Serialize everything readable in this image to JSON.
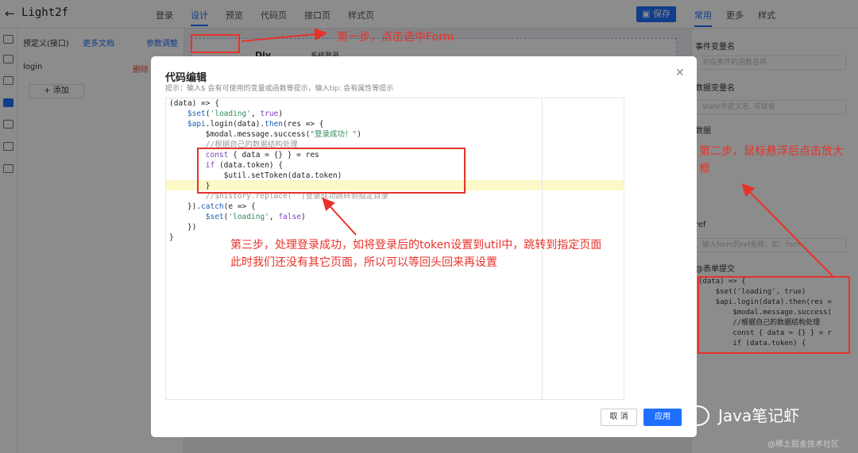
{
  "header": {
    "back_icon": "arrow-left-icon",
    "title": "Light2f",
    "tabs": [
      "登录",
      "设计",
      "预览",
      "代码页",
      "接口页",
      "样式页"
    ],
    "active_tab": "设计",
    "save_label": "保存",
    "right_tabs": [
      "常用",
      "更多",
      "样式"
    ]
  },
  "left_panel": {
    "heading": "预定义(接口)",
    "more_docs": "更多文档",
    "param_adjust": "参数调整",
    "item_name": "login",
    "delete_label": "删除",
    "add_label": "添加"
  },
  "canvas": {
    "div_label": "Div",
    "tag_label": "系统登录"
  },
  "right_panel": {
    "event_var_label": "事件变量名",
    "event_var_placeholder": "对应事件的函数名称",
    "data_var_label": "数据变量名",
    "data_var_placeholder": "state中定义名, 可缺省",
    "data_label": "数据",
    "ref_label": "ref",
    "ref_placeholder": "输入form的ref名称，如：form",
    "submit_label": "@表单提交",
    "code_preview": "(data) => {\n    $set('loading', true)\n    $api.login(data).then(res =\n        $modal.message.success(\n        //根据自己的数据结构处理\n        const { data = {} } = r\n        if (data.token) {"
  },
  "dialog": {
    "title": "代码编辑",
    "hint": "提示：输入$ 会有可使用的变量或函数等提示，输入tip: 会有属性等提示",
    "cancel_label": "取 消",
    "apply_label": "应用",
    "close_icon": "close-icon"
  },
  "annotations": {
    "step1": "第一步，点击选中Form",
    "step2": "第二步，鼠标悬浮后点击放大框",
    "step3_line1": "第三步，处理登录成功，如将登录后的token设置到util中，跳转到指定页面",
    "step3_line2": "此时我们还没有其它页面，所以可以等回头回来再设置"
  },
  "watermark": {
    "main": "Java笔记虾",
    "sub": "@稀土掘金技术社区"
  },
  "colors": {
    "accent": "#1e6fff",
    "annotation": "#e8322a",
    "delete": "#e8463a"
  }
}
